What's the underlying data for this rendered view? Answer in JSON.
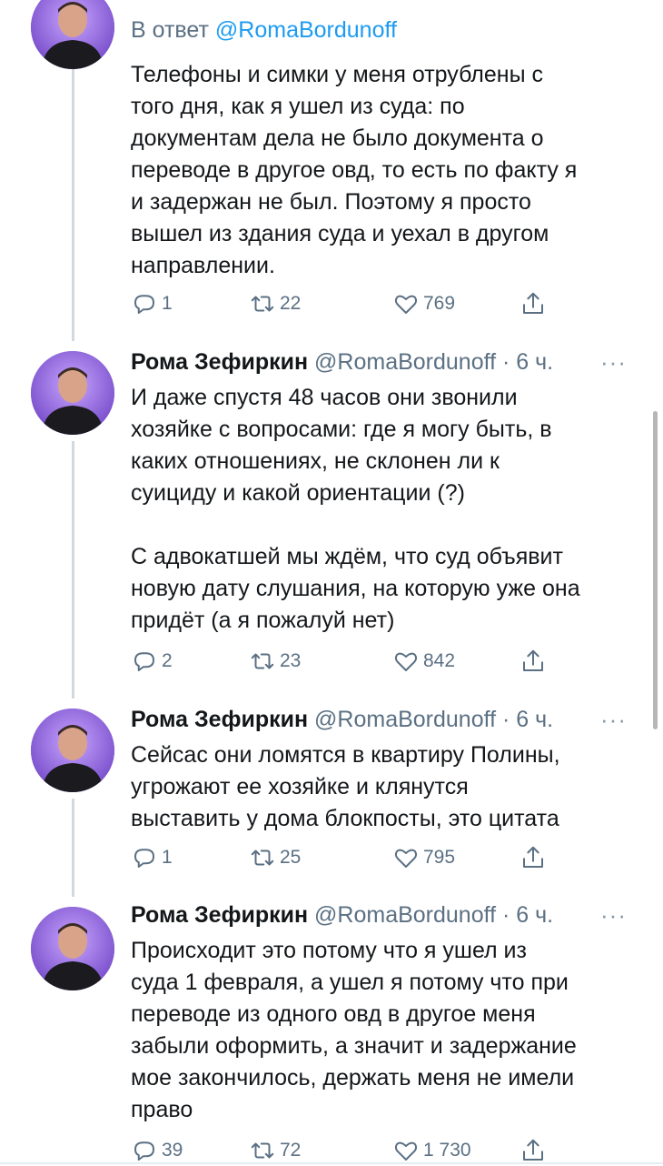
{
  "tweets": [
    {
      "reply_to_prefix": "В ответ",
      "reply_to_handle": "@RomaBordunoff",
      "text": "Телефоны и симки у меня отрублены с\nтого дня, как я ушел из суда: по\nдокументам дела не было документа о\nпереводе в другое овд, то есть по факту я\nи задержан не был. Поэтому я просто\nвышел из здания суда и уехал в другом\nнаправлении.",
      "replies": "1",
      "retweets": "22",
      "likes": "769"
    },
    {
      "name": "Рома Зефиркин",
      "handle": "@RomaBordunoff",
      "time": "· 6 ч.",
      "text": "И даже спустя 48 часов они звонили\nхозяйке с вопросами: где я могу быть, в\nкаких отношениях, не склонен ли к\nсуициду и какой ориентации (?)\n\nС адвокатшей мы ждём, что суд объявит\nновую дату слушания, на которую уже она\nпридёт (а я пожалуй нет)",
      "replies": "2",
      "retweets": "23",
      "likes": "842"
    },
    {
      "name": "Рома Зефиркин",
      "handle": "@RomaBordunoff",
      "time": "· 6 ч.",
      "text": "Сейсас они ломятся в квартиру Полины,\nугрожают ее хозяйке и клянутся\nвыставить у дома блокпосты, это цитата",
      "replies": "1",
      "retweets": "25",
      "likes": "795"
    },
    {
      "name": "Рома Зефиркин",
      "handle": "@RomaBordunoff",
      "time": "· 6 ч.",
      "text": "Происходит это потому что я ушел из\nсуда 1 февраля, а ушел я потому что при\nпереводе из одного овд в другое меня\nзабыли оформить, а значит и задержание\nмое закончилось, держать меня не имели\nправо",
      "replies": "39",
      "retweets": "72",
      "likes": "1 730"
    }
  ],
  "more_symbol": "···",
  "icons": {
    "reply": "reply-icon",
    "retweet": "retweet-icon",
    "like": "heart-icon",
    "share": "share-icon"
  },
  "colors": {
    "accent": "#1d9bf0",
    "muted": "#5b7083",
    "thread_line": "#cfd9de"
  }
}
